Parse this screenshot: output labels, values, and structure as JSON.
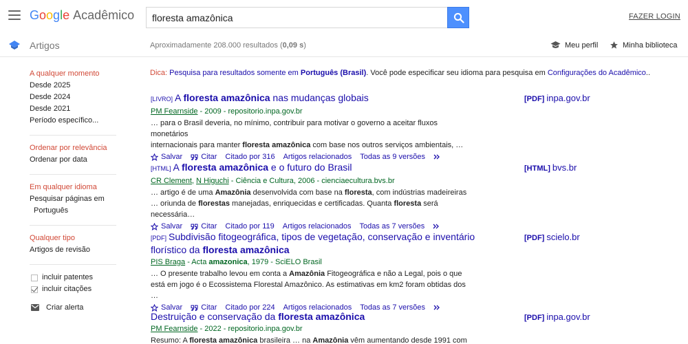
{
  "header": {
    "logo_word": [
      "G",
      "o",
      "o",
      "g",
      "l",
      "e"
    ],
    "logo_sub": "Acadêmico",
    "search_value": "floresta amazônica",
    "login": "FAZER LOGIN"
  },
  "subheader": {
    "section": "Artigos",
    "result_count": "Aproximadamente 208.000 resultados (",
    "result_time": "0,09 s",
    "result_close": ")",
    "profile": "Meu perfil",
    "library": "Minha biblioteca"
  },
  "sidebar": {
    "time": [
      "A qualquer momento",
      "Desde 2025",
      "Desde 2024",
      "Desde 2021",
      "Período específico..."
    ],
    "sort": [
      "Ordenar por relevância",
      "Ordenar por data"
    ],
    "lang": [
      "Em qualquer idioma",
      "Pesquisar páginas em",
      "Português"
    ],
    "type": [
      "Qualquer tipo",
      "Artigos de revisão"
    ],
    "patents": "incluir patentes",
    "citations": "incluir citações",
    "alert": "Criar alerta"
  },
  "tip": {
    "label": "Dica:",
    "p1": "Pesquisa para resultados somente em",
    "p1b": "Português (Brasil)",
    "p2": ". Você pode especificar seu idioma para pesquisa em",
    "p2link": "Configurações do Acadêmico",
    "p3": ".."
  },
  "results": [
    {
      "kind": "[LIVRO]",
      "title_a": "A ",
      "title_b": "floresta amazônica",
      "title_c": " nas mudanças globais",
      "authors": "PM Fearnside",
      "meta": " - 2009 - repositorio.inpa.gov.br",
      "s1": "… para o Brasil deveria, no mínimo, contribuir para motivar o governo a aceitar fluxos monetários",
      "s2a": "internacionais para manter ",
      "s2b": "floresta amazônica",
      "s2c": " com base nos outros serviços ambientais, …",
      "cited": "Citado por 316",
      "versions": "Todas as 9 versões",
      "side_fmt": "[PDF]",
      "side_host": "inpa.gov.br"
    },
    {
      "kind": "[HTML]",
      "title_a": "A ",
      "title_b": "floresta amazônica",
      "title_c": " e o futuro do Brasil",
      "authors1": "CR Clement",
      "authors2": "N Higuchi",
      "meta": " - Ciência e Cultura, 2006 - cienciaecultura.bvs.br",
      "s1a": "… artigo é de uma ",
      "s1b": "Amazônia",
      "s1c": " desenvolvida com base na ",
      "s1d": "floresta",
      "s1e": ", com indústrias madeireiras",
      "s2a": "… oriunda de ",
      "s2b": "florestas",
      "s2c": " manejadas, enriquecidas e certificadas. Quanta ",
      "s2d": "floresta",
      "s2e": " será necessária…",
      "cited": "Citado por 119",
      "versions": "Todas as 7 versões",
      "side_fmt": "[HTML]",
      "side_host": "bvs.br"
    },
    {
      "kind": "[PDF]",
      "title_a": "Subdivisão fitogeográfica, tipos de vegetação, conservação e inventário",
      "title_b": "florístico da ",
      "title_c": "floresta amazônica",
      "authors": "PIS Braga",
      "meta_a": " - Acta ",
      "meta_b": "amazonica",
      "meta_c": ", 1979 - SciELO Brasil",
      "s1a": "… O presente trabalho levou em conta a ",
      "s1b": "Amazônia",
      "s1c": " Fitogeográfica e não a Legal, pois o que",
      "s2": "está em jogo é o Ecossistema Florestal Amazônico. As estimativas em km2 foram obtidas dos …",
      "cited": "Citado por 224",
      "versions": "Todas as 7 versões",
      "side_fmt": "[PDF]",
      "side_host": "scielo.br"
    },
    {
      "title_a": "Destruição e conservação da ",
      "title_b": "floresta amazônica",
      "authors": "PM Fearnside",
      "meta": " - 2022 - repositorio.inpa.gov.br",
      "s1a": "Resumo: A ",
      "s1b": "floresta amazônica",
      "s1c": " brasileira … na ",
      "s1d": "Amazônia",
      "s1e": " vêm aumentando desde 1991 com",
      "side_fmt": "[PDF]",
      "side_host": "inpa.gov.br"
    }
  ],
  "actions": {
    "save": "Salvar",
    "cite": "Citar",
    "related": "Artigos relacionados"
  }
}
